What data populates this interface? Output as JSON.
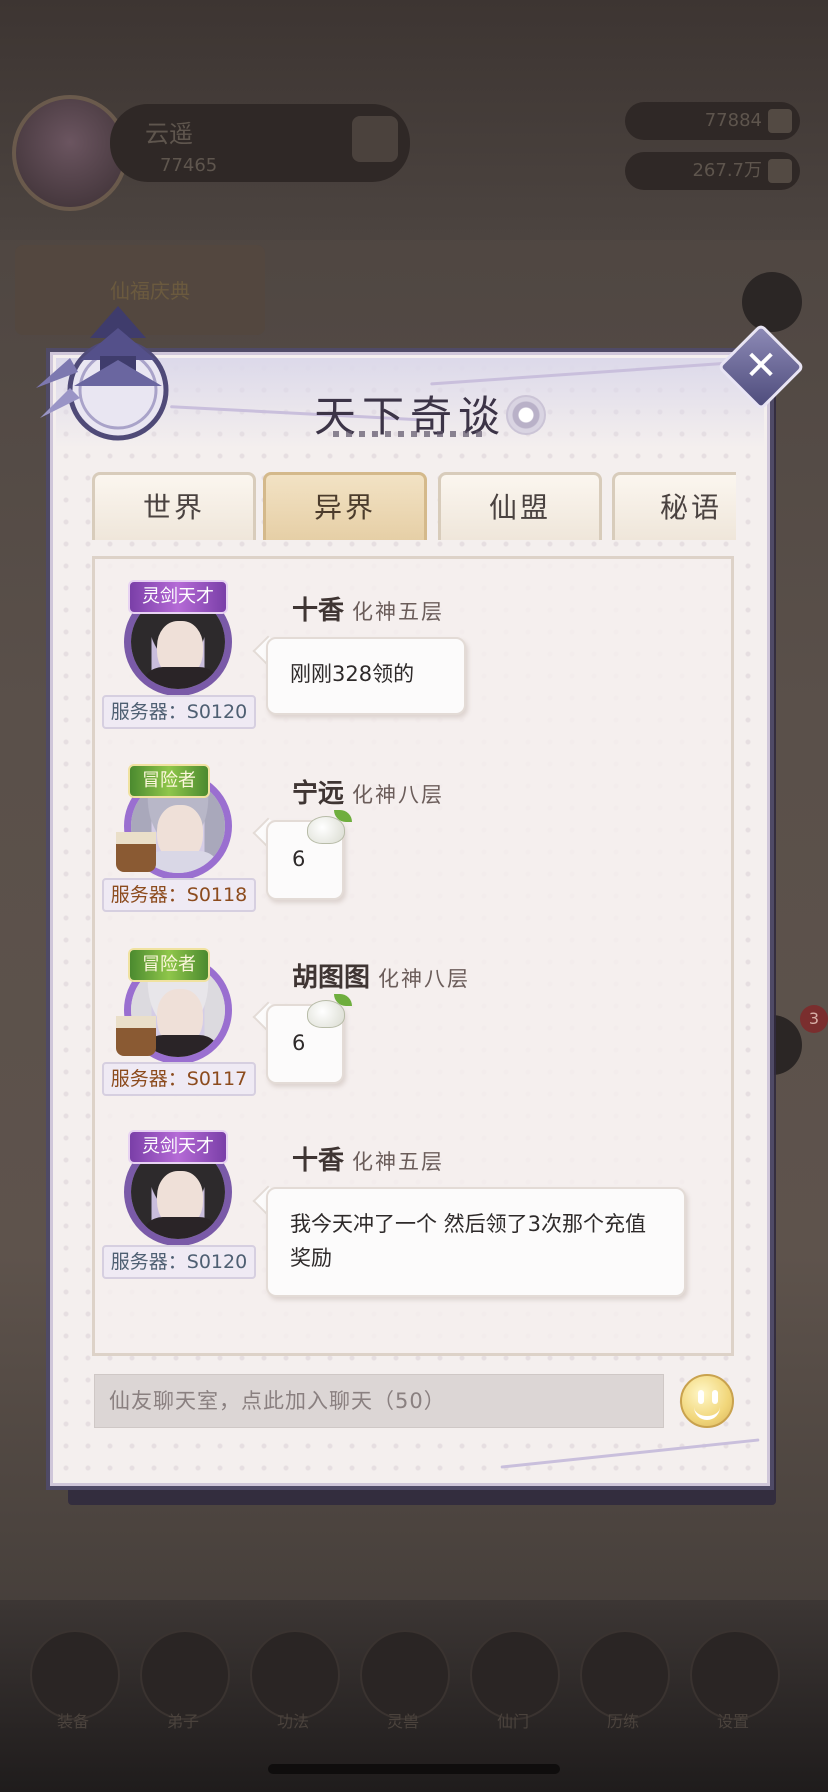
{
  "background": {
    "player_name": "云遥",
    "player_power": "77465",
    "resource_1": "77884",
    "resource_2": "267.7万",
    "event_label": "仙福庆典",
    "right_badge": "3",
    "nav_labels": [
      "装备",
      "弟子",
      "功法",
      "灵兽",
      "仙门",
      "历练",
      "设置"
    ]
  },
  "panel": {
    "title": "天下奇谈",
    "close_label": "✕"
  },
  "tabs": [
    {
      "label": "世界",
      "active": false
    },
    {
      "label": "异界",
      "active": true
    },
    {
      "label": "仙盟",
      "active": false
    },
    {
      "label": "秘语",
      "active": false
    }
  ],
  "messages": [
    {
      "name": "十香",
      "level": "化神五层",
      "title_badge": "灵剑天才",
      "badge_type": "sword",
      "server": "服务器：S0120",
      "server_color": "#4e5f72",
      "text": "刚刚328领的"
    },
    {
      "name": "宁远",
      "level": "化神八层",
      "title_badge": "冒险者",
      "badge_type": "adventurer",
      "server": "服务器：S0118",
      "server_color": "#8c4b1d",
      "text": "6"
    },
    {
      "name": "胡图图",
      "level": "化神八层",
      "title_badge": "冒险者",
      "badge_type": "adventurer",
      "server": "服务器：S0117",
      "server_color": "#8c4b1d",
      "text": "6"
    },
    {
      "name": "十香",
      "level": "化神五层",
      "title_badge": "灵剑天才",
      "badge_type": "sword",
      "server": "服务器：S0120",
      "server_color": "#4e5f72",
      "text": "我今天冲了一个 然后领了3次那个充值奖励"
    }
  ],
  "input": {
    "placeholder": "仙友聊天室，点此加入聊天（50）"
  },
  "colors": {
    "panel_border": "#4f4a66",
    "active_tab": "#e6cfa6",
    "close_button": "#6c69a0"
  }
}
